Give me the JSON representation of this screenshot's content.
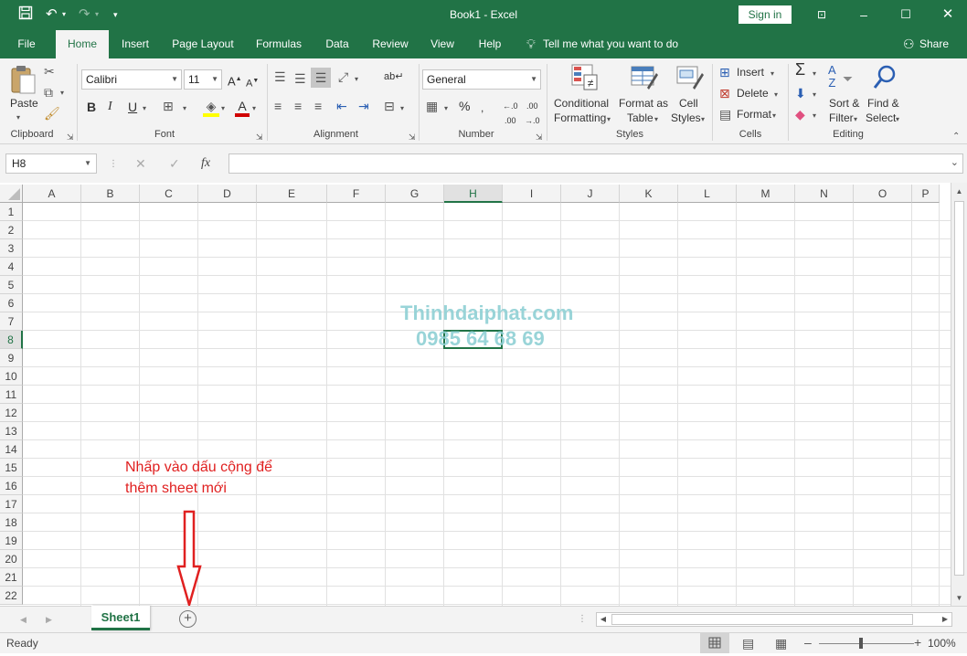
{
  "titlebar": {
    "title": "Book1  -  Excel",
    "sign_in": "Sign in",
    "save_icon": "save-icon",
    "undo_icon": "undo-icon",
    "redo_icon": "redo-icon"
  },
  "menu": {
    "tabs": [
      "File",
      "Home",
      "Insert",
      "Page Layout",
      "Formulas",
      "Data",
      "Review",
      "View",
      "Help"
    ],
    "active": "Home",
    "tell_me": "Tell me what you want to do",
    "share": "Share"
  },
  "ribbon": {
    "clipboard": {
      "label": "Clipboard",
      "paste": "Paste"
    },
    "font": {
      "label": "Font",
      "name": "Calibri",
      "size": "11",
      "bold": "B",
      "italic": "I",
      "underline": "U"
    },
    "alignment": {
      "label": "Alignment"
    },
    "number": {
      "label": "Number",
      "format": "General",
      "percent": "%"
    },
    "styles": {
      "label": "Styles",
      "conditional_1": "Conditional",
      "conditional_2": "Formatting",
      "format_as_1": "Format as",
      "format_as_2": "Table",
      "cell_1": "Cell",
      "cell_2": "Styles"
    },
    "cells": {
      "label": "Cells",
      "insert": "Insert",
      "delete": "Delete",
      "format": "Format"
    },
    "editing": {
      "label": "Editing",
      "sort_1": "Sort &",
      "sort_2": "Filter",
      "find_1": "Find &",
      "find_2": "Select"
    }
  },
  "formula_bar": {
    "name_box": "H8",
    "fx": "fx",
    "value": ""
  },
  "grid": {
    "columns": [
      "A",
      "B",
      "C",
      "D",
      "E",
      "F",
      "G",
      "H",
      "I",
      "J",
      "K",
      "L",
      "M",
      "N",
      "O",
      "P"
    ],
    "rows": [
      "1",
      "2",
      "3",
      "4",
      "5",
      "6",
      "7",
      "8",
      "9",
      "10",
      "11",
      "12",
      "13",
      "14",
      "15",
      "16",
      "17",
      "18",
      "19",
      "20",
      "21",
      "22"
    ],
    "selected_cell": "H8"
  },
  "watermark": {
    "line1": "Thinhdaiphat.com",
    "line2": "0985 64 68 69"
  },
  "annotation": {
    "line1": "Nhấp vào dấu cộng để",
    "line2": "thêm sheet mới"
  },
  "sheets": {
    "tabs": [
      "Sheet1"
    ],
    "active": "Sheet1"
  },
  "status": {
    "ready": "Ready",
    "zoom": "100%"
  },
  "colors": {
    "excel_green": "#217346",
    "annotation_red": "#e02020",
    "watermark": "#8fd0d4"
  }
}
